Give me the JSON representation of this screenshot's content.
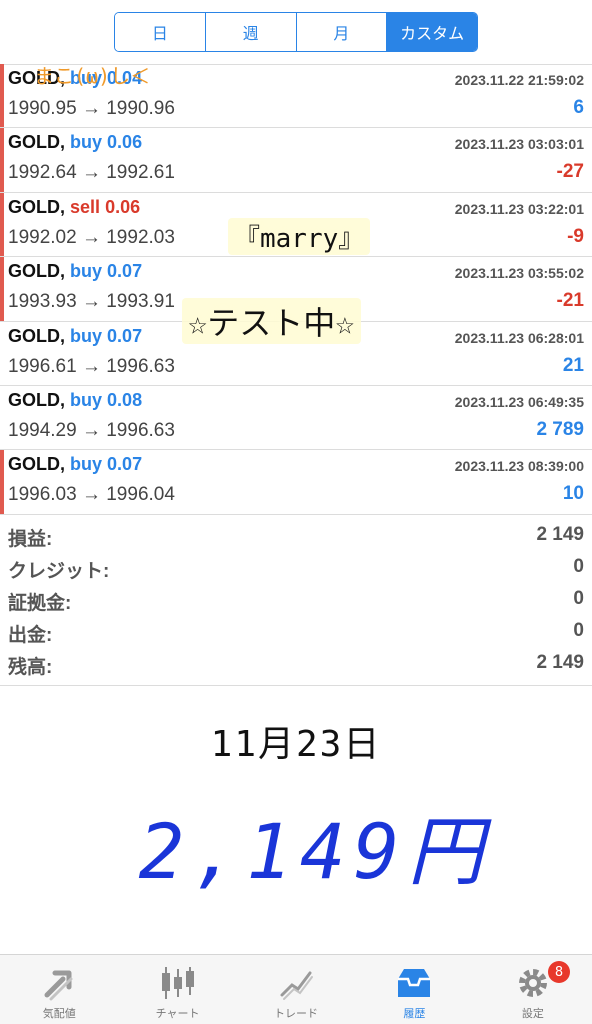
{
  "segments": [
    {
      "label": "日"
    },
    {
      "label": "週"
    },
    {
      "label": "月"
    },
    {
      "label": "カスタム"
    }
  ],
  "trades": [
    {
      "symbol": "GOLD,",
      "side": "buy",
      "volume": "0.04",
      "time": "2023.11.22 21:59:02",
      "prices": "1990.95 → 1990.96",
      "profit": "6"
    },
    {
      "symbol": "GOLD,",
      "side": "buy",
      "volume": "0.06",
      "time": "2023.11.23 03:03:01",
      "prices": "1992.64 → 1992.61",
      "profit": "-27"
    },
    {
      "symbol": "GOLD,",
      "side": "sell",
      "volume": "0.06",
      "time": "2023.11.23 03:22:01",
      "prices": "1992.02 → 1992.03",
      "profit": "-9"
    },
    {
      "symbol": "GOLD,",
      "side": "buy",
      "volume": "0.07",
      "time": "2023.11.23 03:55:02",
      "prices": "1993.93 → 1993.91",
      "profit": "-21"
    },
    {
      "symbol": "GOLD,",
      "side": "buy",
      "volume": "0.07",
      "time": "2023.11.23 06:28:01",
      "prices": "1996.61 → 1996.63",
      "profit": "21"
    },
    {
      "symbol": "GOLD,",
      "side": "buy",
      "volume": "0.08",
      "time": "2023.11.23 06:49:35",
      "prices": "1994.29 → 1996.63",
      "profit": "2 789"
    },
    {
      "symbol": "GOLD,",
      "side": "buy",
      "volume": "0.07",
      "time": "2023.11.23 08:39:00",
      "prices": "1996.03 → 1996.04",
      "profit": "10"
    }
  ],
  "summary": [
    {
      "label": "損益:",
      "value": "2 149"
    },
    {
      "label": "クレジット:",
      "value": "0"
    },
    {
      "label": "証拠金:",
      "value": "0"
    },
    {
      "label": "出金:",
      "value": "0"
    },
    {
      "label": "残高:",
      "value": "2 149"
    }
  ],
  "handwriting": {
    "date": "11月23日",
    "amount": "2,149円"
  },
  "stickers": {
    "top": "まこ(ω)し＜",
    "marry": "『marry』",
    "test": "☆テスト中☆"
  },
  "tabs": [
    {
      "label": "気配値",
      "icon": "quotes-icon"
    },
    {
      "label": "チャート",
      "icon": "chart-icon"
    },
    {
      "label": "トレード",
      "icon": "trade-icon"
    },
    {
      "label": "履歴",
      "icon": "history-icon"
    },
    {
      "label": "設定",
      "icon": "settings-icon",
      "badge": "8"
    }
  ],
  "colors": {
    "accent": "#2a84e6",
    "loss": "#d93a2b",
    "handwriting_amount": "#1a35d8"
  }
}
